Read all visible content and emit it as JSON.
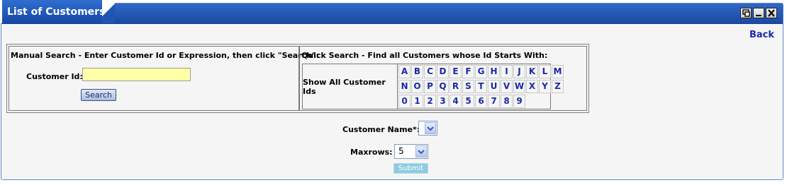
{
  "window": {
    "title": "List of Customers",
    "buttons": [
      "restore-icon",
      "minimize-icon",
      "close-icon"
    ]
  },
  "back_label": "Back",
  "manual_search": {
    "title": "Manual Search - Enter Customer Id or Expression, then click \"Search\":",
    "customer_id_label": "Customer Id:",
    "customer_id_value": "",
    "search_label": "Search"
  },
  "quick_search": {
    "title": "Quick Search - Find all Customers whose Id Starts With:",
    "show_all_label": "Show All Customer Ids",
    "rows": [
      [
        "A",
        "B",
        "C",
        "D",
        "E",
        "F",
        "G",
        "H",
        "I",
        "J",
        "K",
        "L",
        "M"
      ],
      [
        "N",
        "O",
        "P",
        "Q",
        "R",
        "S",
        "T",
        "U",
        "V",
        "W",
        "X",
        "Y",
        "Z"
      ],
      [
        "0",
        "1",
        "2",
        "3",
        "4",
        "5",
        "6",
        "7",
        "8",
        "9"
      ]
    ]
  },
  "customer_name": {
    "label": "Customer Name*:",
    "selected": ""
  },
  "maxrows": {
    "label": "Maxrows:",
    "selected": "5"
  },
  "submit_label": "Submit",
  "colors": {
    "titlebar": "#1f55b5",
    "link": "#1d2aa8",
    "input_bg": "#ffffa6",
    "submit_bg": "#8ccbe0"
  }
}
